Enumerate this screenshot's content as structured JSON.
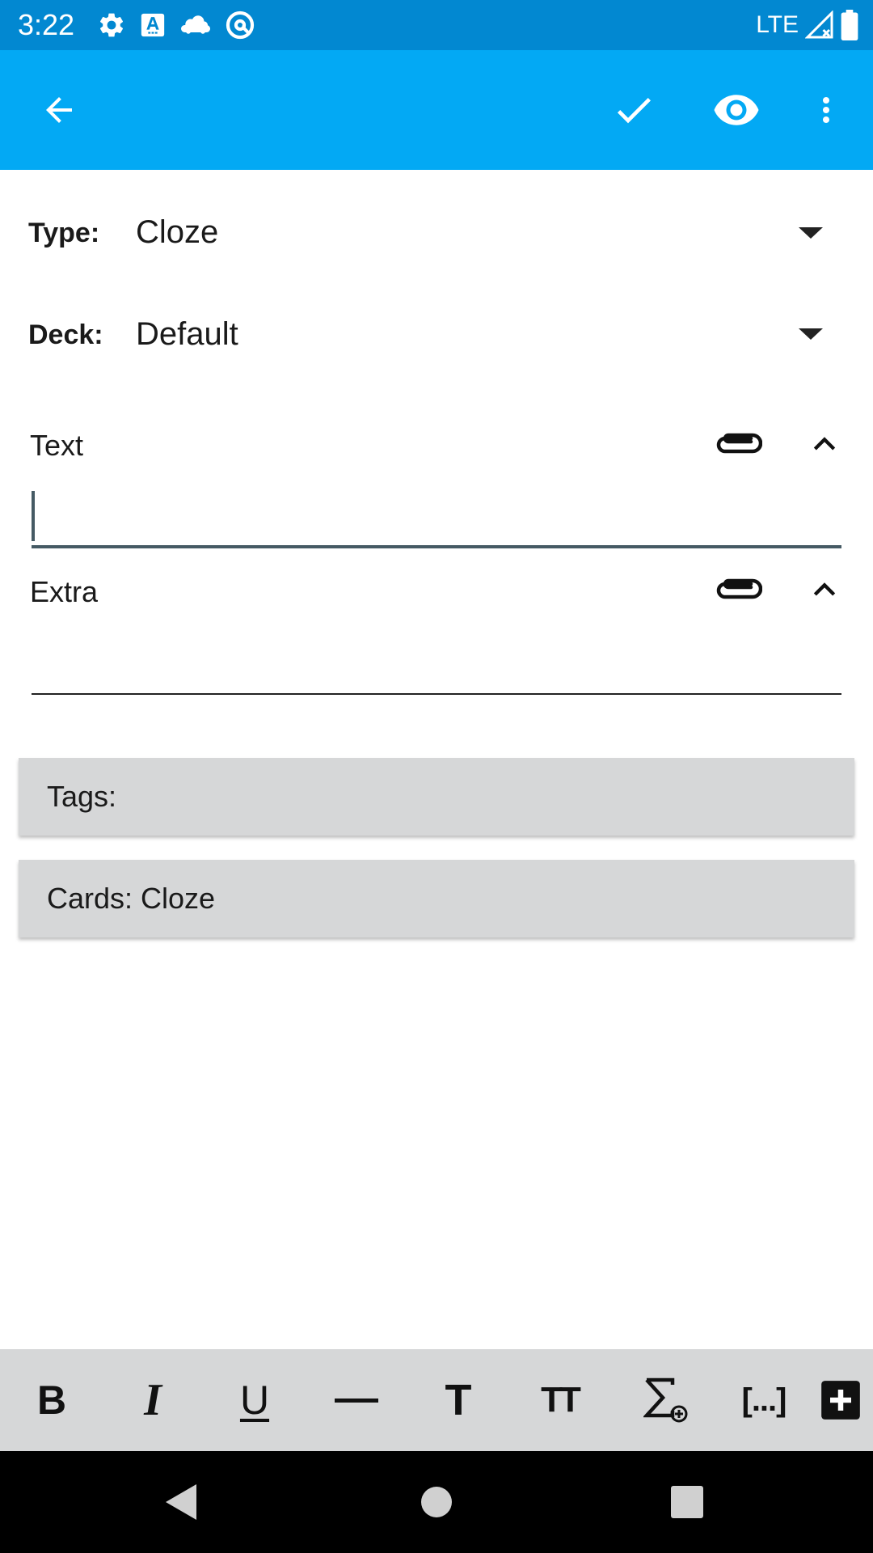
{
  "status_bar": {
    "time": "3:22",
    "network": "LTE",
    "left_icons": [
      "gear-icon",
      "text-a-icon",
      "cloud-car-icon",
      "at-sign-icon"
    ],
    "right_icons": [
      "signal-icon",
      "battery-icon"
    ]
  },
  "app_bar": {
    "icons": [
      "back-arrow-icon",
      "check-icon",
      "eye-icon",
      "more-vert-icon"
    ],
    "color": "#03a9f4"
  },
  "note_type": {
    "label": "Type:",
    "value": "Cloze"
  },
  "deck": {
    "label": "Deck:",
    "value": "Default"
  },
  "fields": [
    {
      "label": "Text",
      "value": ""
    },
    {
      "label": "Extra",
      "value": ""
    }
  ],
  "tags": {
    "label": "Tags:"
  },
  "cards": {
    "label": "Cards: Cloze"
  },
  "toolbar": {
    "bold": "B",
    "italic": "I",
    "underline": "U",
    "title": "T",
    "font_size": "TT",
    "cloze": "[...]"
  },
  "colors": {
    "status_bar": "#0288d1",
    "app_bar": "#03a9f4",
    "panel": "#d6d7d8",
    "input_active": "#455a64"
  }
}
